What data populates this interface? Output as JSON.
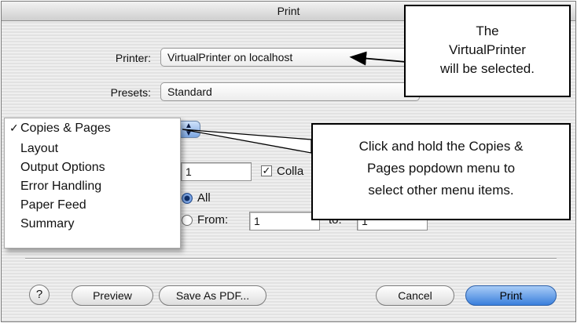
{
  "dialog": {
    "title": "Print",
    "printer_label": "Printer:",
    "printer_value": "VirtualPrinter on localhost",
    "presets_label": "Presets:",
    "presets_value": "Standard"
  },
  "panel_menu": {
    "items": [
      {
        "label": "Copies & Pages",
        "checked": true,
        "check_mark": "✓"
      },
      {
        "label": "Layout",
        "checked": false
      },
      {
        "label": "Output Options",
        "checked": false
      },
      {
        "label": "Error Handling",
        "checked": false
      },
      {
        "label": "Paper Feed",
        "checked": false
      },
      {
        "label": "Summary",
        "checked": false
      }
    ]
  },
  "copies": {
    "value": "1",
    "collate_label": "Colla",
    "collate_checked": true
  },
  "pages": {
    "all_label": "All",
    "all_selected": true,
    "from_label": "From:",
    "from_value": "1",
    "to_label": "to:",
    "to_value": "1"
  },
  "buttons": {
    "help": "?",
    "preview": "Preview",
    "save_as_pdf": "Save As PDF...",
    "cancel": "Cancel",
    "print": "Print"
  },
  "callouts": {
    "printer_note": [
      "The",
      "VirtualPrinter",
      "will be selected."
    ],
    "menu_note": [
      "Click and hold the Copies &",
      "Pages popdown menu to",
      "select other menu items."
    ]
  },
  "colors": {
    "primary_button": "#3a7fdc",
    "stepper": "#7ba5e0",
    "window_stripe": "#e2e2e2"
  }
}
